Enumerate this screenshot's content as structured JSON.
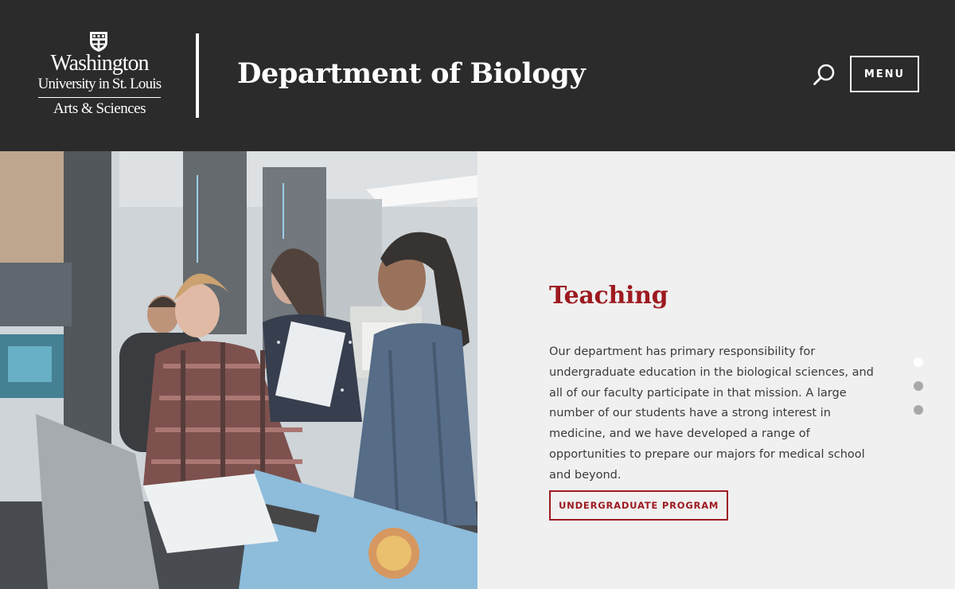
{
  "header": {
    "logo": {
      "line1": "Washington",
      "line2": "University in St. Louis",
      "line3": "Arts & Sciences"
    },
    "site_title": "Department of Biology",
    "search_icon": "search-icon",
    "menu_label": "MENU"
  },
  "hero": {
    "image_alt": "Students working together at laptops in a biology lab",
    "heading": "Teaching",
    "body": "Our department has primary responsibility for undergraduate education in the biological sciences, and all of our faculty participate in that mission. A large number of our students have a strong interest in medicine, and we have developed a range of opportunities to prepare our majors for medical school and beyond.",
    "cta_label": "UNDERGRADUATE PROGRAM",
    "slides": {
      "count": 3,
      "active": 1
    }
  },
  "colors": {
    "header_bg": "#2b2b2b",
    "accent": "#9d1a20",
    "panel_bg": "#f0f0f0"
  }
}
